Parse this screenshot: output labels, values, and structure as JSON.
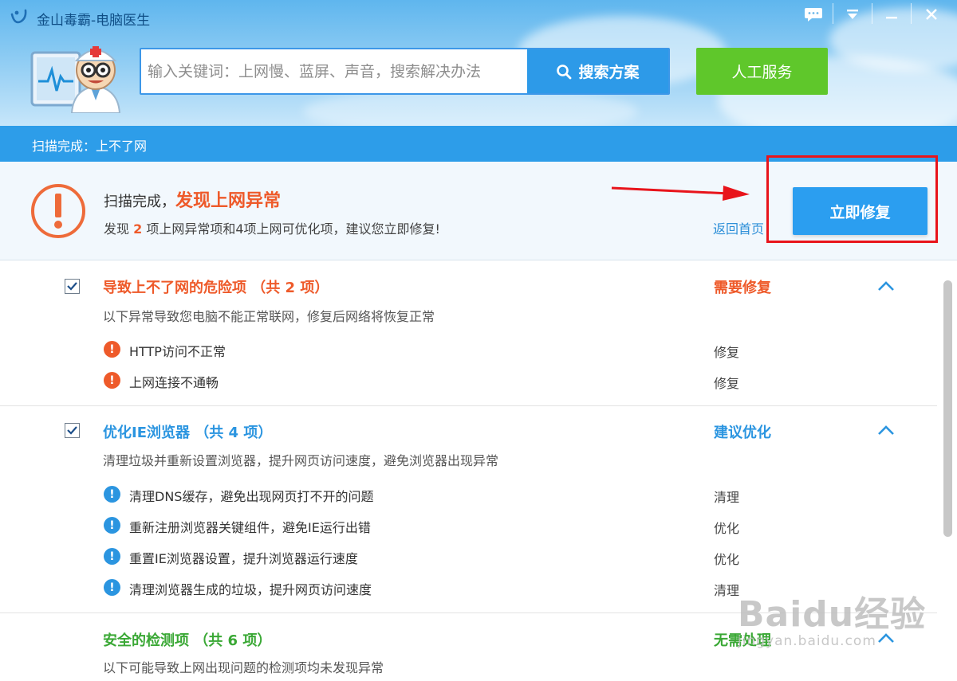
{
  "window": {
    "title": "金山毒霸-电脑医生",
    "controls": [
      "chat-icon",
      "menu-dropdown-icon",
      "minimize-icon",
      "close-icon"
    ]
  },
  "search": {
    "placeholder": "输入关键词：上网慢、蓝屏、声音，搜索解决办法",
    "button_label": "搜索方案"
  },
  "human_service_label": "人工服务",
  "status_bar": "扫描完成：上不了网",
  "summary": {
    "title_prefix": "扫描完成，",
    "title_highlight": "发现上网异常",
    "desc_prefix": "发现 ",
    "desc_count": "2",
    "desc_suffix": " 项上网异常项和4项上网可优化项，建议您立即修复!",
    "back_link": "返回首页",
    "fix_button": "立即修复"
  },
  "groups": [
    {
      "title": "导致上不了网的危险项 （共 2 项）",
      "desc": "以下异常导致您电脑不能正常联网，修复后网络将恢复正常",
      "status": "需要修复",
      "color": "#ee5a2a",
      "checked": true,
      "items": [
        {
          "icon": "!",
          "text": "HTTP访问不正常",
          "action": "修复"
        },
        {
          "icon": "!",
          "text": "上网连接不通畅",
          "action": "修复"
        }
      ]
    },
    {
      "title": "优化IE浏览器 （共 4 项）",
      "desc": "清理垃圾并重新设置浏览器，提升网页访问速度，避免浏览器出现异常",
      "status": "建议优化",
      "color": "#2b95e0",
      "checked": true,
      "items": [
        {
          "icon": "!",
          "text": "清理DNS缓存，避免出现网页打不开的问题",
          "action": "清理"
        },
        {
          "icon": "!",
          "text": "重新注册浏览器关键组件，避免IE运行出错",
          "action": "优化"
        },
        {
          "icon": "!",
          "text": "重置IE浏览器设置，提升浏览器运行速度",
          "action": "优化"
        },
        {
          "icon": "!",
          "text": "清理浏览器生成的垃圾，提升网页访问速度",
          "action": "清理"
        }
      ]
    },
    {
      "title": "安全的检测项 （共 6 项）",
      "desc": "以下可能导致上网出现问题的检测项均未发现异常",
      "status": "无需处理",
      "color": "#3aa835",
      "checked": false,
      "items": []
    }
  ],
  "watermark": {
    "main": "Baidu经验",
    "sub": "jingyan.baidu.com"
  }
}
